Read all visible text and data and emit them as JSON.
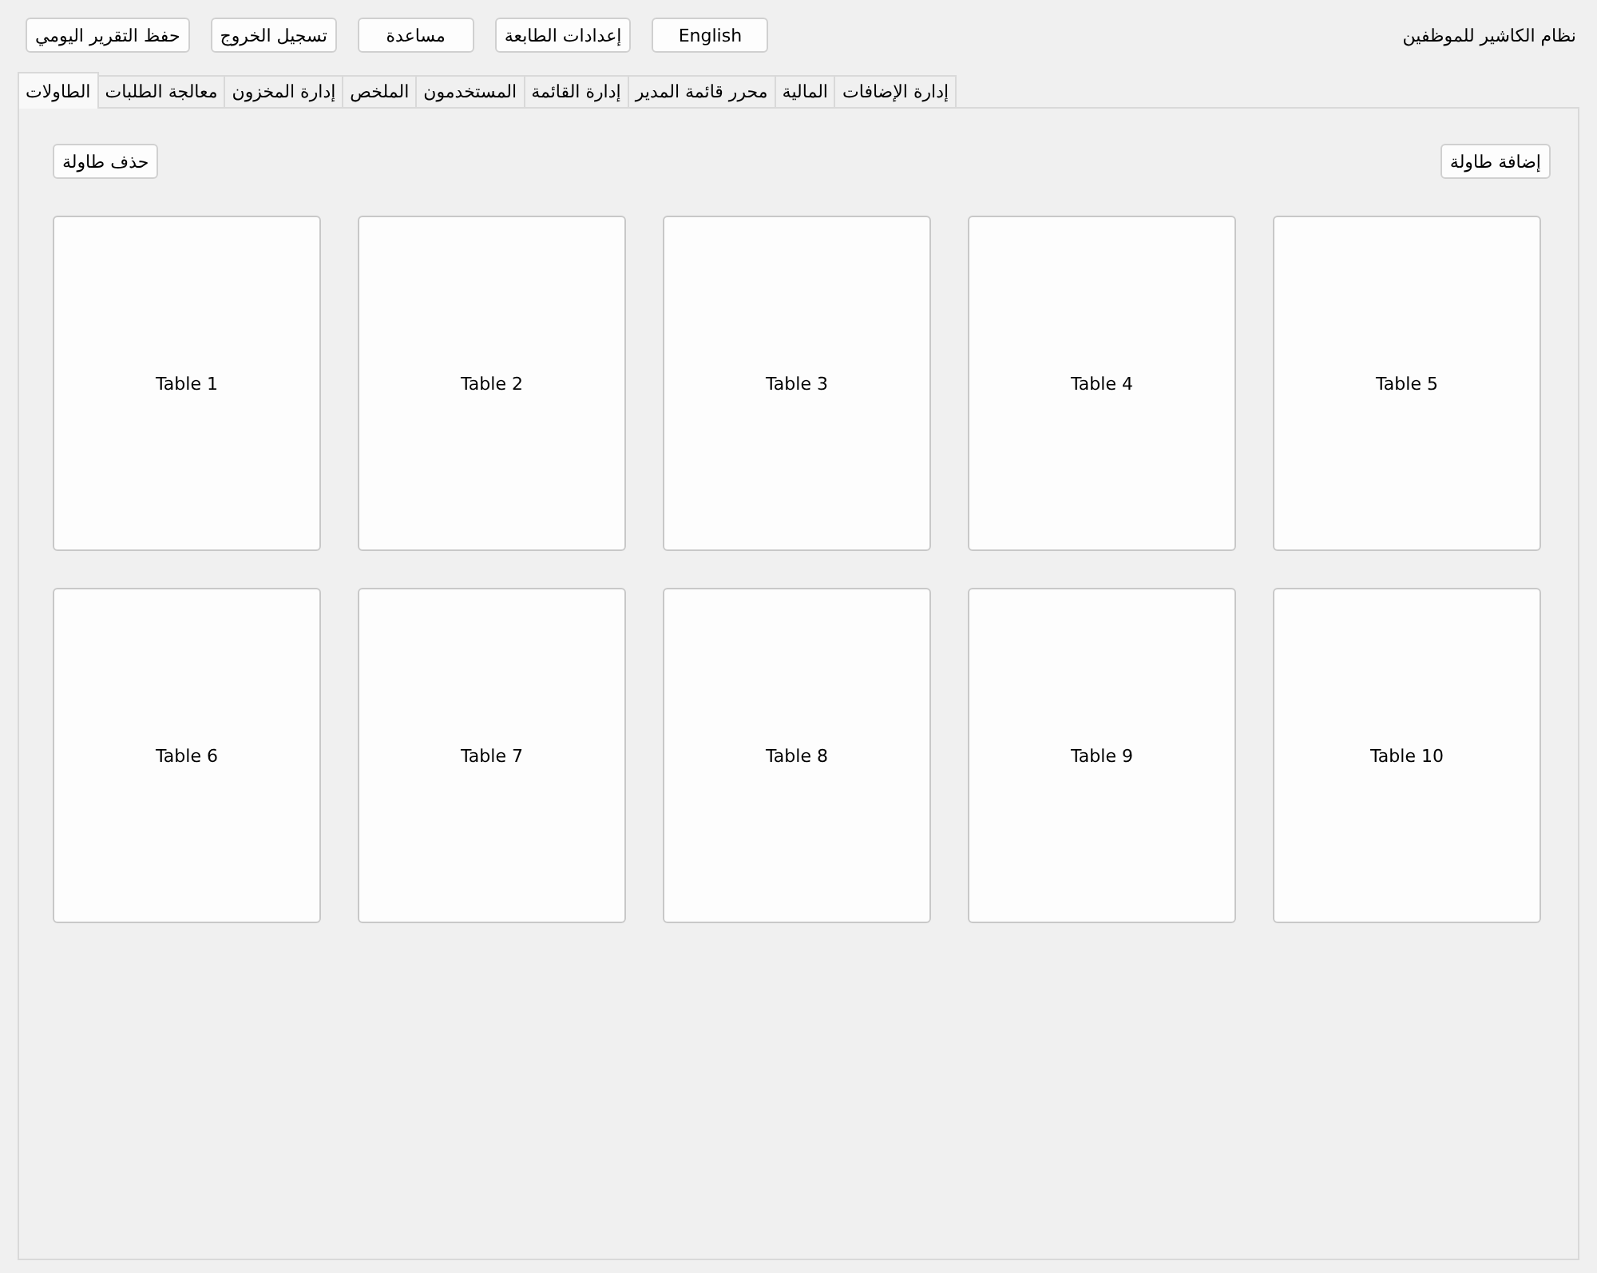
{
  "window": {
    "title": "نظام الكاشير للموظفين"
  },
  "header_buttons": [
    "English",
    "إعدادات الطابعة",
    "مساعدة",
    "تسجيل الخروج",
    "حفظ التقرير اليومي"
  ],
  "tabs": [
    {
      "label": "إدارة الإضافات",
      "selected": false
    },
    {
      "label": "المالية",
      "selected": false
    },
    {
      "label": "محرر قائمة المدير",
      "selected": false
    },
    {
      "label": "إدارة القائمة",
      "selected": false
    },
    {
      "label": "المستخدمون",
      "selected": false
    },
    {
      "label": "الملخص",
      "selected": false
    },
    {
      "label": "إدارة المخزون",
      "selected": false
    },
    {
      "label": "معالجة الطلبات",
      "selected": false
    },
    {
      "label": "الطاولات",
      "selected": true
    }
  ],
  "toolbar_buttons": [
    "إضافة طاولة",
    "حذف طاولة"
  ],
  "tables": [
    "Table 5",
    "Table 4",
    "Table 3",
    "Table 2",
    "Table 1",
    "Table 10",
    "Table 9",
    "Table 8",
    "Table 7",
    "Table 6"
  ]
}
